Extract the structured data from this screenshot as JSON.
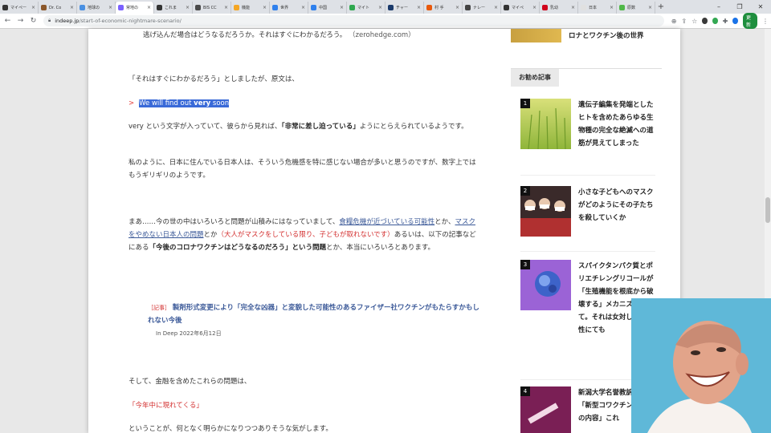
{
  "browser": {
    "tabs": [
      {
        "label": "マイペー",
        "color": "#333333"
      },
      {
        "label": "Dr. Co",
        "color": "#8b572a"
      },
      {
        "label": "地球の",
        "color": "#4a90e2"
      },
      {
        "label": "常地の",
        "color": "#7b61ff",
        "active": true
      },
      {
        "label": "これま",
        "color": "#333333"
      },
      {
        "label": "BIS CC",
        "color": "#4a4a4a"
      },
      {
        "label": "機能",
        "color": "#f5a623"
      },
      {
        "label": "世界",
        "color": "#2f80ed"
      },
      {
        "label": "中国",
        "color": "#2f80ed"
      },
      {
        "label": "マイト",
        "color": "#2fa84f"
      },
      {
        "label": "チャー",
        "color": "#1b3a6b"
      },
      {
        "label": "村 手",
        "color": "#e8590c"
      },
      {
        "label": "ナレー",
        "color": "#444444"
      },
      {
        "label": "マイペ",
        "color": "#333333"
      },
      {
        "label": "乳幼",
        "color": "#d0021b"
      },
      {
        "label": "日本",
        "color": "#e0e0e0"
      },
      {
        "label": "原数",
        "color": "#50b848"
      }
    ],
    "new_tab": "+",
    "window_controls": {
      "minimize": "–",
      "maximize": "❐",
      "close": "✕"
    },
    "url_host": "indeep.jp",
    "url_path": "/start-of-economic-nightmare-scenario/",
    "update_label": "更新"
  },
  "article": {
    "top_quote": "逃げ込んだ場合はどうなるだろうか。それはすぐにわかるだろう。",
    "top_quote_source": "（zerohedge.com）",
    "p1": "「それはすぐにわかるだろう」としましたが、原文は、",
    "bq_marker": ">",
    "bq_pre": "We will find out ",
    "bq_bold": "very",
    "bq_post": " soon",
    "p2_a": "very という文字が入っていて、彼らから見れば、",
    "p2_b": "「非常に差し迫っている」",
    "p2_c": "ようにとらえられているようです。",
    "p3": "私のように、日本に住んでいる日本人は、そういう危機感を特に感じない場合が多いと思うのですが、数字上ではもうギリギリのようです。",
    "p4_a": "まあ……今の世の中はいろいろと問題が山積みにはなっていまして、",
    "p4_link1": "食糧危機が近づいている可能性",
    "p4_b": "とか、",
    "p4_link2": "マスクをやめない日本人の問題",
    "p4_c": "とか",
    "p4_red": "（大人がマスクをしている限り、子どもが取れないです）",
    "p4_d": "あるいは、以下の記事などにある",
    "p4_strong": "「今後のコロナワクチンはどうなるのだろう」という問題",
    "p4_e": "とか、本当にいろいろとあります。",
    "related_tag": "［記事］",
    "related_title": "製剤形式変更により「完全な凶器」と変貌した可能性のあるファイザー社ワクチンがもたらすかもしれない今後",
    "related_meta": "In Deep 2022年6月12日",
    "p5": "そして、金融を含めたこれらの問題は、",
    "p6": "「今年中に現れてくる」",
    "p7": "ということが、何となく明らかになりつつありそうな気がします。"
  },
  "sidebar": {
    "top_title": "ロナとワクチン後の世界",
    "heading": "お勧め記事",
    "items": [
      {
        "rank": "1",
        "title": "遺伝子編集を発端としたヒトを含めたあらゆる生物種の完全な絶滅への道筋が見えてしまった"
      },
      {
        "rank": "2",
        "title": "小さな子どもへのマスクがどのようにその子たちを殺していくか"
      },
      {
        "rank": "3",
        "title": "スパイクタンパク質とポリエチレングリコールが「生殖機能を根底から破壊する」メカニズムべて。それは女対しても男性にても"
      },
      {
        "rank": "4",
        "title": "新潟大学名誉教訴える「新型コワクチンの危険の内容」これ"
      }
    ]
  }
}
